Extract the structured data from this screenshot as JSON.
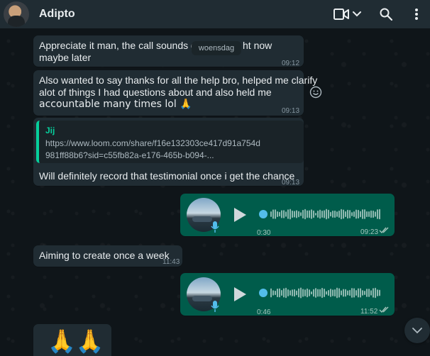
{
  "header": {
    "contact_name": "Adipto",
    "icons": [
      "video-call-icon",
      "chevron-down-icon",
      "search-icon",
      "more-options-icon"
    ]
  },
  "date_chip": "woensdag",
  "messages": [
    {
      "direction": "in",
      "text_line1": "Appreciate it man, the call sounds goo",
      "text_line1b": "ht now",
      "text_line2": "maybe later",
      "time": "09:12"
    },
    {
      "direction": "in",
      "lines": [
        "Also wanted to say thanks for all the help bro, helped me clarify",
        "alot of things I had questions about and also held me",
        "accountable many times lol 🙏"
      ],
      "time": "09:13"
    },
    {
      "direction": "in",
      "quote_author": "Jij",
      "quote_lines": [
        "https://www.loom.com/share/f16e132303ce417d91a754d",
        "981ff88b6?sid=c55fb82a-e176-465b-b094-..."
      ],
      "text": "Will definitely record that testimonial once i get the chance",
      "time": "09:13"
    },
    {
      "direction": "out",
      "type": "voice",
      "duration": "0:30",
      "time": "09:23",
      "status": "read"
    },
    {
      "direction": "in",
      "text": "Aiming to create once a week",
      "time": "11:43"
    },
    {
      "direction": "out",
      "type": "voice",
      "duration": "0:46",
      "time": "11:52",
      "status": "read"
    },
    {
      "direction": "in",
      "text": "🙏🙏"
    }
  ],
  "colors": {
    "header_bg": "#202c33",
    "incoming_bubble": "#202c33",
    "outgoing_bubble": "#005c4b",
    "accent": "#06cf9c",
    "read_ticks": "#53bdeb"
  }
}
